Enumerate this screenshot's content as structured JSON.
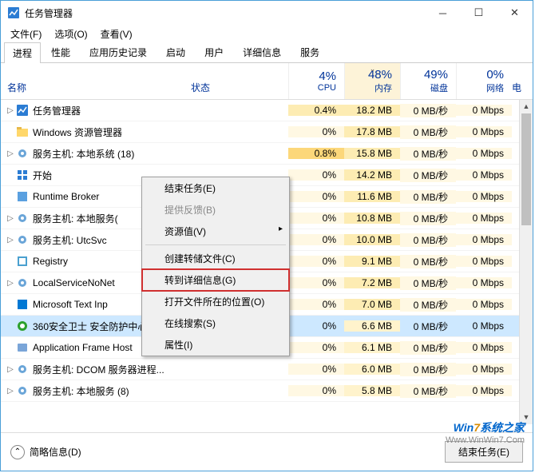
{
  "window": {
    "title": "任务管理器"
  },
  "menu": {
    "file": "文件(F)",
    "options": "选项(O)",
    "view": "查看(V)"
  },
  "tabs": [
    "进程",
    "性能",
    "应用历史记录",
    "启动",
    "用户",
    "详细信息",
    "服务"
  ],
  "headers": {
    "name": "名称",
    "status": "状态",
    "cpu_pct": "4%",
    "cpu": "CPU",
    "mem_pct": "48%",
    "mem": "内存",
    "disk_pct": "49%",
    "disk": "磁盘",
    "net_pct": "0%",
    "net": "网络",
    "extra": "电"
  },
  "rows": [
    {
      "exp": true,
      "icon": "taskmgr",
      "name": "任务管理器",
      "cpu": "0.4%",
      "cpu_c": "m",
      "mem": "18.2 MB",
      "disk": "0 MB/秒",
      "net": "0 Mbps"
    },
    {
      "exp": false,
      "icon": "explorer",
      "name": "Windows 资源管理器",
      "cpu": "0%",
      "mem": "17.8 MB",
      "disk": "0 MB/秒",
      "net": "0 Mbps"
    },
    {
      "exp": true,
      "icon": "gear",
      "name": "服务主机: 本地系统 (18)",
      "cpu": "0.8%",
      "cpu_c": "h",
      "mem": "15.8 MB",
      "disk": "0 MB/秒",
      "net": "0 Mbps"
    },
    {
      "exp": false,
      "icon": "start",
      "name": "开始",
      "cpu": "0%",
      "mem": "14.2 MB",
      "disk": "0 MB/秒",
      "net": "0 Mbps"
    },
    {
      "exp": false,
      "icon": "rt",
      "name": "Runtime Broker",
      "cpu": "0%",
      "mem": "11.6 MB",
      "disk": "0 MB/秒",
      "net": "0 Mbps"
    },
    {
      "exp": true,
      "icon": "gear",
      "name": "服务主机: 本地服务(",
      "cpu": "0%",
      "mem": "10.8 MB",
      "disk": "0 MB/秒",
      "net": "0 Mbps"
    },
    {
      "exp": true,
      "icon": "gear",
      "name": "服务主机: UtcSvc",
      "cpu": "0%",
      "mem": "10.0 MB",
      "disk": "0 MB/秒",
      "net": "0 Mbps"
    },
    {
      "exp": false,
      "icon": "reg",
      "name": "Registry",
      "cpu": "0%",
      "mem": "9.1 MB",
      "disk": "0 MB/秒",
      "net": "0 Mbps"
    },
    {
      "exp": true,
      "icon": "gear",
      "name": "LocalServiceNoNet",
      "cpu": "0%",
      "mem": "7.2 MB",
      "disk": "0 MB/秒",
      "net": "0 Mbps"
    },
    {
      "exp": false,
      "icon": "ms",
      "name": "Microsoft Text Inp",
      "cpu": "0%",
      "mem": "7.0 MB",
      "disk": "0 MB/秒",
      "net": "0 Mbps"
    },
    {
      "exp": false,
      "icon": "360",
      "name": "360安全卫士 安全防护中心模块...",
      "cpu": "0%",
      "mem": "6.6 MB",
      "mem_c": "l",
      "disk": "0 MB/秒",
      "net": "0 Mbps",
      "sel": true
    },
    {
      "exp": false,
      "icon": "app",
      "name": "Application Frame Host",
      "cpu": "0%",
      "mem": "6.1 MB",
      "mem_c": "l",
      "disk": "0 MB/秒",
      "net": "0 Mbps"
    },
    {
      "exp": true,
      "icon": "gear",
      "name": "服务主机: DCOM 服务器进程...",
      "cpu": "0%",
      "mem": "6.0 MB",
      "mem_c": "l",
      "disk": "0 MB/秒",
      "net": "0 Mbps"
    },
    {
      "exp": true,
      "icon": "gear",
      "name": "服务主机: 本地服务 (8)",
      "cpu": "0%",
      "mem": "5.8 MB",
      "mem_c": "l",
      "disk": "0 MB/秒",
      "net": "0 Mbps"
    }
  ],
  "context": {
    "end_task": "结束任务(E)",
    "feedback": "提供反馈(B)",
    "resource": "资源值(V)",
    "dump": "创建转储文件(C)",
    "goto_details": "转到详细信息(G)",
    "open_loc": "打开文件所在的位置(O)",
    "search": "在线搜索(S)",
    "props": "属性(I)"
  },
  "bottom": {
    "fewer": "简略信息(D)",
    "end": "结束任务(E)"
  },
  "watermark": {
    "l1a": "Win",
    "l1b": "7",
    "l1c": "系统之家",
    "l2": "Www.WinWin7.Com"
  }
}
